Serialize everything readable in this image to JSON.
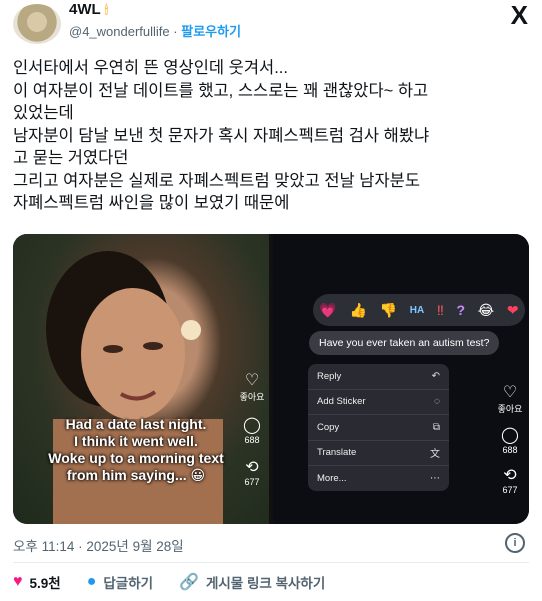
{
  "author": {
    "name": "4WL",
    "handle": "@4_wonderfullife",
    "follow_label": "팔로우하기",
    "avatar_icon": "avatar-image",
    "candle_icon": "candle-icon"
  },
  "logo": {
    "icon": "x-logo",
    "glyph": "X"
  },
  "tweet_lines": [
    "인서타에서 우연히 뜬 영상인데 웃겨서...",
    "이 여자분이 전날 데이트를 했고, 스스로는 꽤 괜찮았다~ 하고",
    "있었는데",
    "남자분이 담날 보낸 첫 문자가 혹시 자폐스펙트럼 검사 해봤냐",
    "고 묻는 거였다던",
    "그리고 여자분은 실제로 자폐스펙트럼 맞았고 전날 남자분도",
    "자폐스펙트럼 싸인을 많이 보였기 때문에"
  ],
  "media": {
    "left_caption": [
      "Had a date last night.",
      "I think it went well.",
      "Woke up to a morning text",
      "from him saying... 😀"
    ],
    "left_side": {
      "like_label": "좋아요",
      "comment_count": "688",
      "repost_count": "677"
    },
    "right_side": {
      "like_label": "좋아요",
      "comment_count": "688",
      "repost_count": "677"
    },
    "reactions": [
      "💗",
      "👍",
      "👎",
      "HA",
      "‼",
      "?",
      "😂",
      "❤"
    ],
    "message_bubble": "Have you ever taken an autism test?",
    "context_menu": [
      {
        "label": "Reply",
        "icon": "reply-icon",
        "glyph": "↶"
      },
      {
        "label": "Add Sticker",
        "icon": "sticker-icon",
        "glyph": "◌"
      },
      {
        "label": "Copy",
        "icon": "copy-icon",
        "glyph": "⧉"
      },
      {
        "label": "Translate",
        "icon": "translate-icon",
        "glyph": "文"
      },
      {
        "label": "More...",
        "icon": "more-icon",
        "glyph": "⋯"
      }
    ]
  },
  "timestamp": "오후 11:14 · 2025년 9월 28일",
  "actions": {
    "like_count": "5.9천",
    "reply_label": "답글하기",
    "copy_link_label": "게시물 링크 복사하기"
  }
}
